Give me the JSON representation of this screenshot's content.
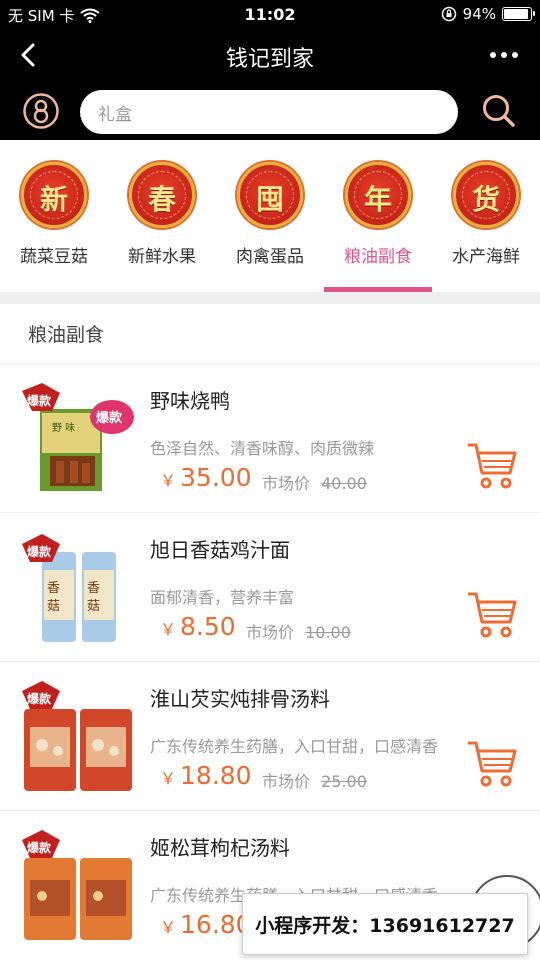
{
  "status_bar": {
    "carrier": "无 SIM 卡",
    "time": "11:02",
    "battery": "94%",
    "battery_level": 0.94
  },
  "nav": {
    "title": "钱记到家"
  },
  "search": {
    "placeholder": "礼盒"
  },
  "categories": [
    {
      "char": "新",
      "label": "蔬菜豆菇"
    },
    {
      "char": "春",
      "label": "新鲜水果"
    },
    {
      "char": "囤",
      "label": "肉禽蛋品"
    },
    {
      "char": "年",
      "label": "粮油副食",
      "active": true
    },
    {
      "char": "货",
      "label": "水产海鲜"
    }
  ],
  "section_title": "粮油副食",
  "badge_label": "爆款",
  "products": [
    {
      "name": "野味烧鸭",
      "desc": "色泽自然、清香味醇、肉质微辣",
      "currency": "￥",
      "price": "35.00",
      "market_label": "市场价",
      "market_price": "40.00"
    },
    {
      "name": "旭日香菇鸡汁面",
      "desc": "面郁清香，营养丰富",
      "currency": "￥",
      "price": "8.50",
      "market_label": "市场价",
      "market_price": "10.00"
    },
    {
      "name": "淮山芡实炖排骨汤料",
      "desc": "广东传统养生药膳，入口甘甜，口感清香",
      "currency": "￥",
      "price": "18.80",
      "market_label": "市场价",
      "market_price": "25.00"
    },
    {
      "name": "姬松茸枸杞汤料",
      "desc": "广东传统养生药膳，入口甘甜，口感清香",
      "currency": "￥",
      "price": "16.80",
      "market_label": "",
      "market_price": ""
    }
  ],
  "promo_banner": "小程序开发：13691612727",
  "colors": {
    "accent_pink": "#e0548a",
    "price_orange": "#ec6b2d",
    "cart_orange": "#f06b32",
    "header_bg": "#000000"
  },
  "icons": {
    "back": "chevron-left-icon",
    "more": "more-dots-icon",
    "user": "user-icon",
    "search": "search-icon",
    "cart": "cart-icon"
  }
}
